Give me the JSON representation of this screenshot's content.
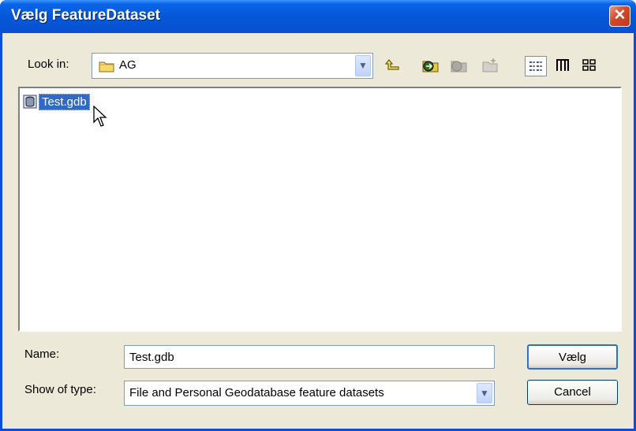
{
  "window": {
    "title": "Vælg FeatureDataset",
    "close_glyph": "✕"
  },
  "toolbar": {
    "look_in_label": "Look in:",
    "look_in_value": "AG",
    "icons": [
      "up-one-level-icon",
      "connect-folder-icon",
      "disconnect-folder-icon",
      "new-folder-icon",
      "list-view-icon",
      "details-view-icon",
      "thumbnails-view-icon"
    ]
  },
  "files": [
    {
      "name": "Test.gdb",
      "icon": "geodatabase-icon",
      "selected": true
    }
  ],
  "form": {
    "name_label": "Name:",
    "name_value": "Test.gdb",
    "type_label": "Show of type:",
    "type_value": "File and Personal Geodatabase feature datasets"
  },
  "buttons": {
    "ok": "Vælg",
    "cancel": "Cancel"
  },
  "colors": {
    "title_bar": "#0a4de0",
    "selection": "#316ac5",
    "dialog_bg": "#ece9d8"
  }
}
